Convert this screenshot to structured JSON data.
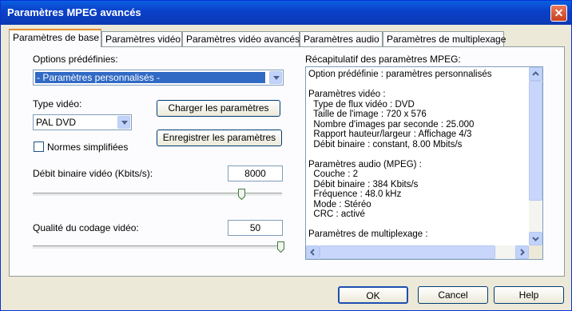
{
  "window": {
    "title": "Paramètres MPEG avancés",
    "close_label": "✕"
  },
  "tabs": [
    {
      "label": "Paramètres de base",
      "active": true
    },
    {
      "label": "Paramètres vidéo"
    },
    {
      "label": "Paramètres vidéo avancés"
    },
    {
      "label": "Paramètres audio"
    },
    {
      "label": "Paramètres de multiplexage"
    }
  ],
  "basic": {
    "presets_label": "Options prédéfinies:",
    "presets_value": "- Paramètres personnalisés -",
    "video_type_label": "Type vidéo:",
    "video_type_value": "PAL DVD",
    "load_button": "Charger les paramètres",
    "save_button": "Enregistrer les paramètres",
    "simplified_norms_label": "Normes simplifiées",
    "simplified_norms_checked": false,
    "bitrate_label": "Débit binaire vidéo (Kbits/s):",
    "bitrate_value": "8000",
    "quality_label": "Qualité du codage vidéo:",
    "quality_value": "50"
  },
  "summary": {
    "label": "Récapitulatif des paramètres MPEG:",
    "text": "Option prédéfinie : paramètres personnalisés\n\nParamètres vidéo :\n  Type de flux vidéo : DVD\n  Taille de l'image : 720 x 576\n  Nombre d'images par seconde : 25.000\n  Rapport hauteur/largeur : Affichage 4/3\n  Débit binaire : constant, 8.00 Mbits/s\n\nParamètres audio (MPEG) :\n  Couche : 2\n  Débit binaire : 384 Kbits/s\n  Fréquence : 48.0 kHz\n  Mode : Stéréo\n  CRC : activé\n\nParamètres de multiplexage :"
  },
  "footer": {
    "ok": "OK",
    "cancel": "Cancel",
    "help": "Help"
  }
}
